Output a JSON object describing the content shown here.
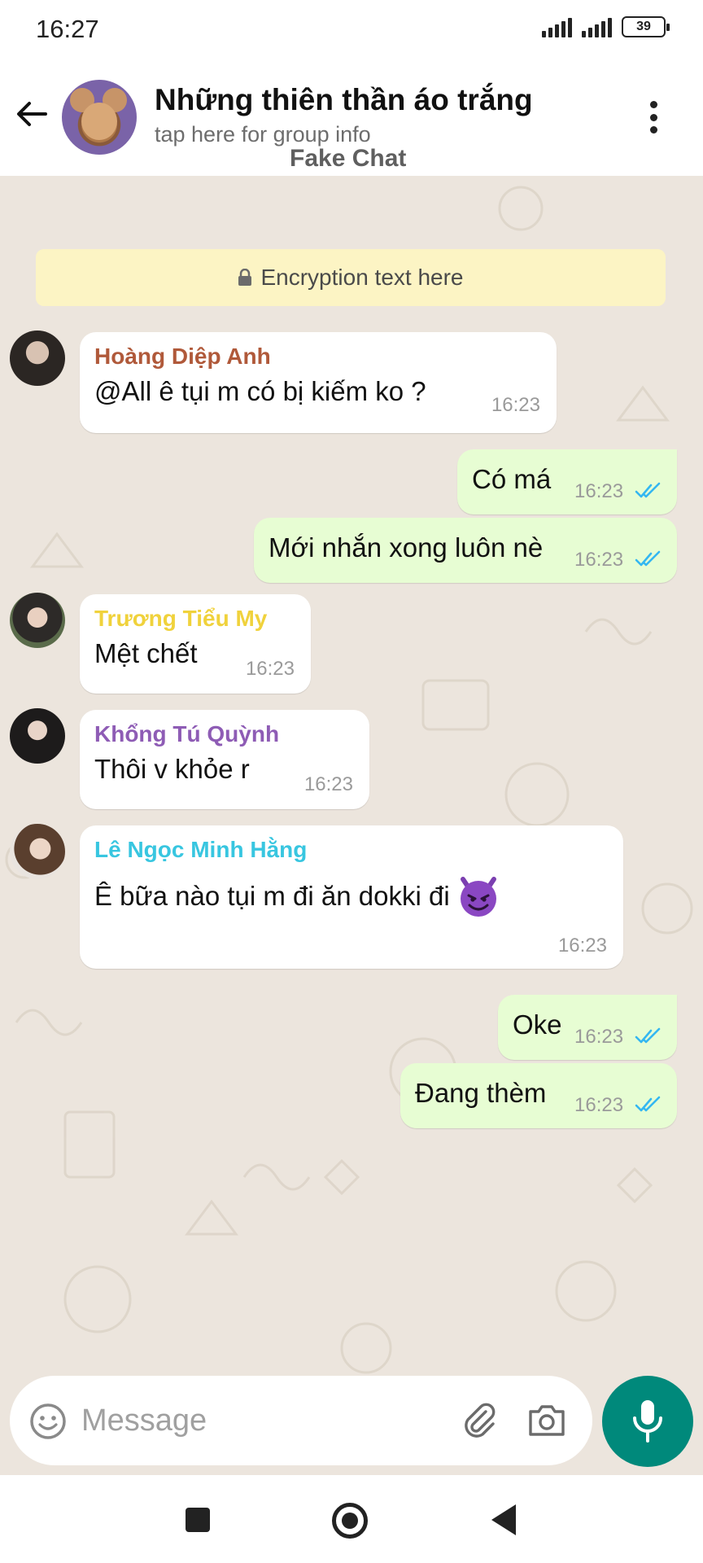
{
  "status_bar": {
    "time": "16:27",
    "battery": "39"
  },
  "header": {
    "title": "Những thiên thần áo trắng",
    "subtitle": "tap here for group info",
    "watermark": "Fake Chat"
  },
  "encryption_notice": "Encryption text here",
  "messages": [
    {
      "direction": "in",
      "sender": "Hoàng Diệp Anh",
      "sender_color": "#b0593a",
      "text": "@All ê tụi m có bị kiếm ko ?",
      "time": "16:23"
    },
    {
      "direction": "out",
      "text": "Có má",
      "time": "16:23",
      "read": true
    },
    {
      "direction": "out",
      "text": "Mới nhắn xong luôn nè",
      "time": "16:23",
      "read": true
    },
    {
      "direction": "in",
      "sender": "Trương Tiểu My",
      "sender_color": "#f0d23c",
      "text": "Mệt chết",
      "time": "16:23"
    },
    {
      "direction": "in",
      "sender": "Khổng Tú Quỳnh",
      "sender_color": "#8e5cb5",
      "text": "Thôi v khỏe r",
      "time": "16:23"
    },
    {
      "direction": "in",
      "sender": "Lê Ngọc Minh Hằng",
      "sender_color": "#38c6e0",
      "text": "Ê bữa nào tụi m đi ăn dokki đi",
      "emoji": "smiling-devil",
      "time": "16:23"
    },
    {
      "direction": "out",
      "text": "Oke",
      "time": "16:23",
      "read": true
    },
    {
      "direction": "out",
      "text": "Đang thèm",
      "time": "16:23",
      "read": true
    }
  ],
  "composer": {
    "placeholder": "Message"
  },
  "colors": {
    "chat_background": "#ece5dd",
    "outgoing_bubble": "#e7fdd3",
    "incoming_bubble": "#ffffff",
    "read_ticks": "#34b7f1",
    "mic_button": "#00897b",
    "encryption_banner": "#fcf4c4"
  }
}
